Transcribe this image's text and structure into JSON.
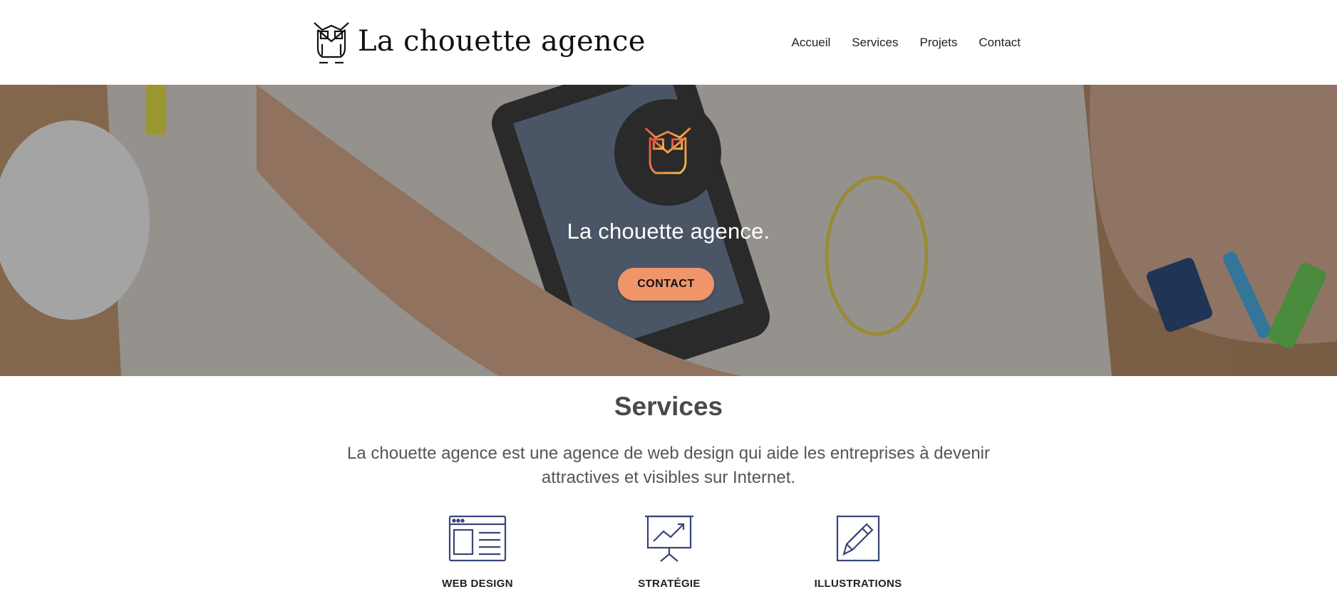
{
  "header": {
    "logo_text": "La chouette agence",
    "nav": [
      "Accueil",
      "Services",
      "Projets",
      "Contact"
    ]
  },
  "hero": {
    "title": "La chouette agence.",
    "cta_label": "CONTACT",
    "colors": {
      "overlay": "#282828",
      "cta": "#f0956a",
      "badge": "#2a2a2a",
      "owl_gradient_start": "#e24a43",
      "owl_gradient_end": "#f2c14e"
    }
  },
  "services": {
    "title": "Services",
    "description": "La chouette agence est une agence de web design qui aide les entreprises à devenir attractives et visibles sur Internet.",
    "items": [
      {
        "label": "WEB DESIGN",
        "icon": "web-design-icon"
      },
      {
        "label": "STRATÉGIE",
        "icon": "strategy-presentation-icon"
      },
      {
        "label": "ILLUSTRATIONS",
        "icon": "pencil-icon"
      }
    ],
    "icon_color": "#3a4577"
  }
}
